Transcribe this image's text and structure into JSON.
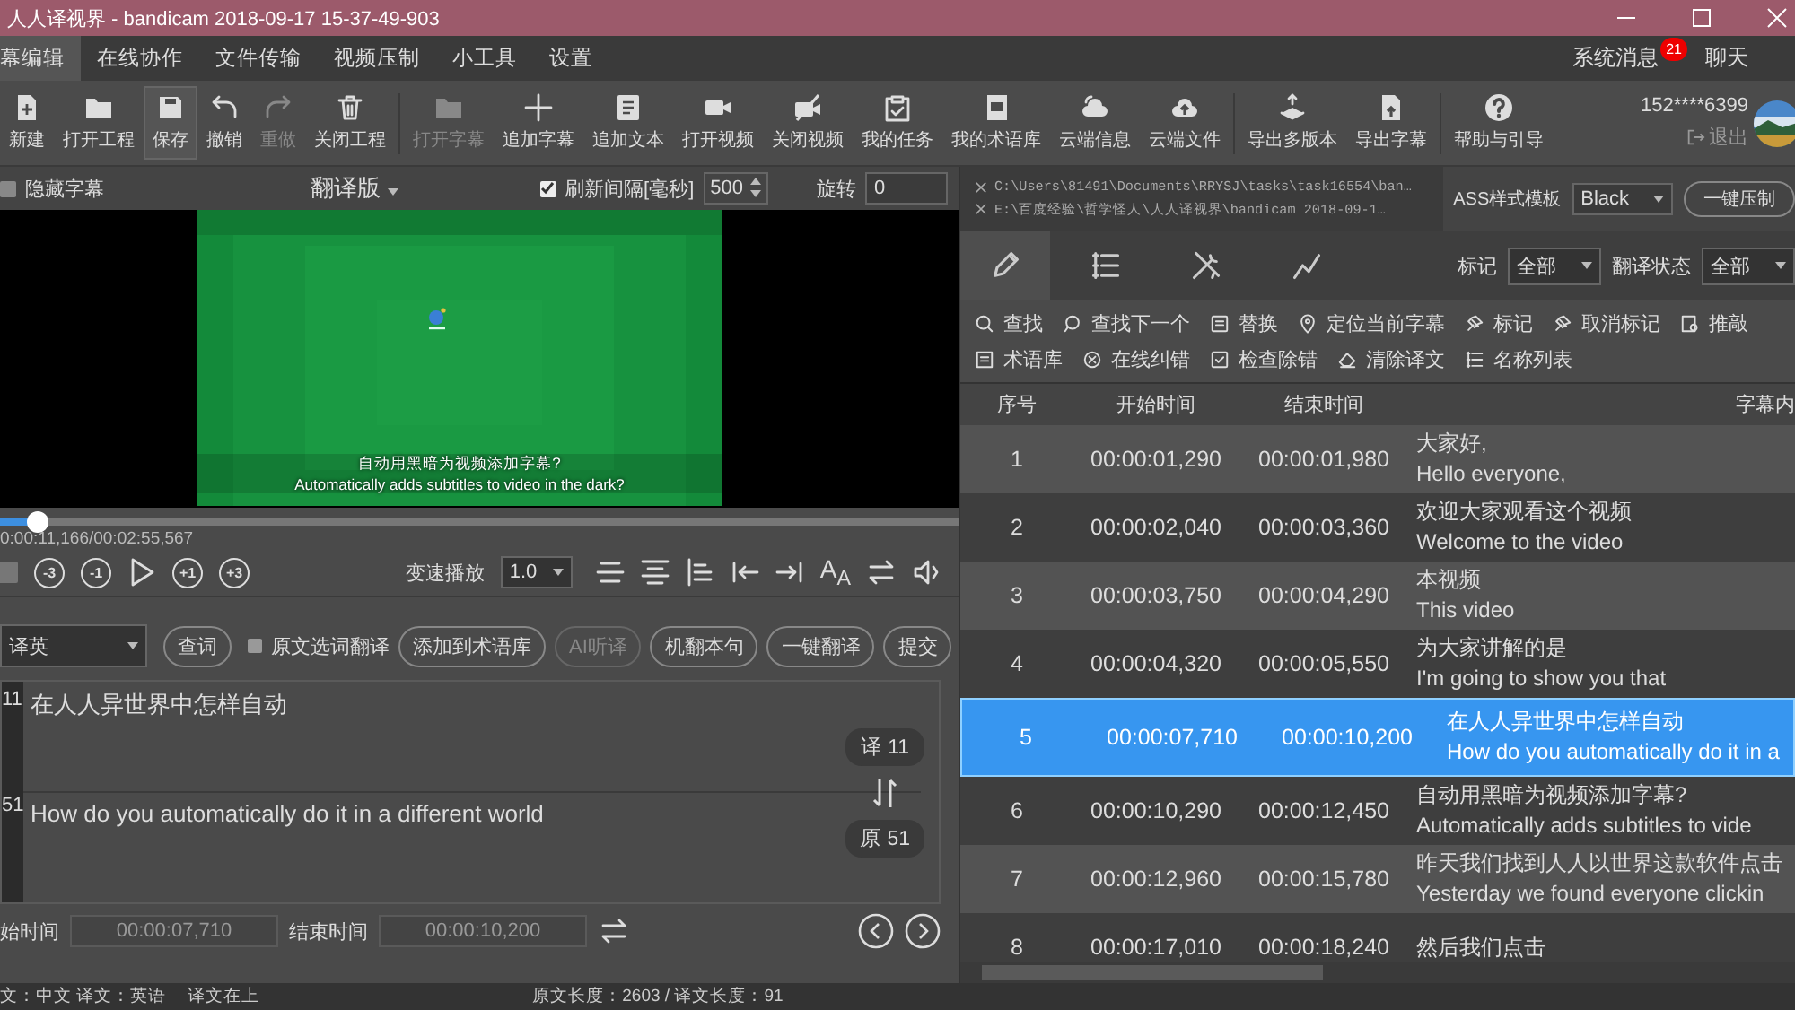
{
  "window": {
    "title": "人人译视界 - bandicam 2018-09-17 15-37-49-903"
  },
  "menu": {
    "items": [
      {
        "label": "幕编辑",
        "selected": true
      },
      {
        "label": "在线协作",
        "selected": false
      },
      {
        "label": "文件传输",
        "selected": false
      },
      {
        "label": "视频压制",
        "selected": false
      },
      {
        "label": "小工具",
        "selected": false
      },
      {
        "label": "设置",
        "selected": false
      }
    ],
    "messages": {
      "label": "系统消息",
      "badge": "21"
    },
    "chat": "聊天"
  },
  "toolbar": {
    "groups": [
      [
        {
          "label": "新建",
          "kind": "doc-plus",
          "disabled": false,
          "hovered": false
        },
        {
          "label": "打开工程",
          "kind": "folder",
          "disabled": false,
          "hovered": false
        },
        {
          "label": "保存",
          "kind": "floppy",
          "disabled": false,
          "hovered": true
        },
        {
          "label": "撤销",
          "kind": "undo",
          "disabled": false,
          "hovered": false
        },
        {
          "label": "重做",
          "kind": "redo",
          "disabled": true,
          "hovered": false
        },
        {
          "label": "关闭工程",
          "kind": "trash",
          "disabled": false,
          "hovered": false
        }
      ],
      [
        {
          "label": "打开字幕",
          "kind": "folder",
          "disabled": true,
          "hovered": false
        },
        {
          "label": "追加字幕",
          "kind": "plus",
          "disabled": false,
          "hovered": false
        },
        {
          "label": "追加文本",
          "kind": "document",
          "disabled": false,
          "hovered": false
        },
        {
          "label": "打开视频",
          "kind": "camera",
          "disabled": false,
          "hovered": false
        },
        {
          "label": "关闭视频",
          "kind": "camera-off",
          "disabled": false,
          "hovered": false
        },
        {
          "label": "我的任务",
          "kind": "clipboard",
          "disabled": false,
          "hovered": false
        },
        {
          "label": "我的术语库",
          "kind": "book",
          "disabled": false,
          "hovered": false
        },
        {
          "label": "云端信息",
          "kind": "cloud",
          "disabled": false,
          "hovered": false
        },
        {
          "label": "云端文件",
          "kind": "cloud-upload",
          "disabled": false,
          "hovered": false
        }
      ],
      [
        {
          "label": "导出多版本",
          "kind": "layers",
          "disabled": false,
          "hovered": false
        },
        {
          "label": "导出字幕",
          "kind": "file-upload",
          "disabled": false,
          "hovered": false
        }
      ],
      [
        {
          "label": "帮助与引导",
          "kind": "help",
          "disabled": false,
          "hovered": false
        }
      ]
    ]
  },
  "user": {
    "account": "152****6399",
    "logout": "退出"
  },
  "player": {
    "hide_subtitles": {
      "label": "隐藏字幕",
      "checked": false
    },
    "version": "翻译版",
    "refresh": {
      "label": "刷新间隔[毫秒]",
      "checked": true,
      "value": "500"
    },
    "rotate": {
      "label": "旋转",
      "value": "0"
    },
    "video": {
      "kind": "picture",
      "subtitle_lines": [
        "自动用黑暗为视频添加字幕?",
        "Automatically adds subtitles to video in the dark?"
      ]
    },
    "progress": {
      "level": 0.04
    },
    "time": "0:00:11,166/00:02:55,567",
    "controls": [
      {
        "kind": "stop"
      },
      {
        "kind": "rewind",
        "label": "-3"
      },
      {
        "kind": "rewind",
        "label": "-1"
      },
      {
        "kind": "play"
      },
      {
        "kind": "forward",
        "label": "+1"
      },
      {
        "kind": "forward",
        "label": "+3"
      }
    ],
    "speed": {
      "label": "变速播放",
      "value": "1.0"
    },
    "tools": [
      {
        "kind": "align-center"
      },
      {
        "kind": "align-middle"
      },
      {
        "kind": "align-left"
      },
      {
        "kind": "tab-left"
      },
      {
        "kind": "tab-right"
      },
      {
        "kind": "font",
        "label": "A$_{A}$"
      },
      {
        "kind": "swap"
      },
      {
        "kind": "speaker"
      }
    ]
  },
  "translator": {
    "direction": "译英",
    "items": [
      {
        "kind": "button",
        "label": "查词",
        "disabled": false
      },
      {
        "kind": "checkbox",
        "label": "原文选词翻译",
        "checked": false
      },
      {
        "kind": "button",
        "label": "添加到术语库",
        "disabled": false
      },
      {
        "kind": "button",
        "label": "AI听译",
        "disabled": true
      },
      {
        "kind": "button",
        "label": "机翻本句",
        "disabled": false
      },
      {
        "kind": "button",
        "label": "一键翻译",
        "disabled": false
      },
      {
        "kind": "button",
        "label": "提交",
        "disabled": false
      }
    ]
  },
  "editor": {
    "translation": {
      "line": "11",
      "text": "在人人异世界中怎样自动",
      "badge": "译 11"
    },
    "original": {
      "line": "51",
      "text": "How do you automatically do it in a different world",
      "badge": "原 51"
    }
  },
  "timing": {
    "start_label": "始时间",
    "start": "00:00:07,710",
    "end_label": "结束时间",
    "end": "00:00:10,200"
  },
  "status_bar": {
    "languages": "文：中文 译文：英语",
    "order": "译文在上",
    "lengths": "原文长度：2603 / 译文长度：91"
  },
  "files": {
    "paths": [
      "C:\\Users\\81491\\Documents\\RRYSJ\\tasks\\task16554\\ban…",
      "E:\\百度经验\\哲学怪人\\人人译视界\\bandicam 2018-09-1…"
    ],
    "style_label": "ASS样式模板",
    "style": "Black",
    "burn": "一键压制"
  },
  "panel_tabs": [
    {
      "kind": "pencil",
      "selected": true
    },
    {
      "kind": "list",
      "selected": false
    },
    {
      "kind": "tools",
      "selected": false
    },
    {
      "kind": "chart",
      "selected": false
    }
  ],
  "filters": [
    {
      "label": "标记",
      "value": "全部"
    },
    {
      "label": "翻译状态",
      "value": "全部"
    }
  ],
  "actions": [
    [
      {
        "kind": "search",
        "label": "查找"
      },
      {
        "kind": "search-next",
        "label": "查找下一个"
      },
      {
        "kind": "replace",
        "label": "替换"
      },
      {
        "kind": "location",
        "label": "定位当前字幕"
      },
      {
        "kind": "pin",
        "label": "标记"
      },
      {
        "kind": "pin",
        "label": "取消标记"
      },
      {
        "kind": "review",
        "label": "推敲"
      }
    ],
    [
      {
        "kind": "glossary",
        "label": "术语库"
      },
      {
        "kind": "x-circle",
        "label": "在线纠错"
      },
      {
        "kind": "check-box",
        "label": "检查除错"
      },
      {
        "kind": "eraser",
        "label": "清除译文"
      },
      {
        "kind": "list",
        "label": "名称列表"
      }
    ]
  ],
  "table": {
    "columns": [
      "序号",
      "开始时间",
      "结束时间",
      "字幕内"
    ],
    "rows": [
      {
        "index": "1",
        "start": "00:00:01,290",
        "end": "00:00:01,980",
        "source": "大家好,",
        "target": "Hello everyone,",
        "selected": false
      },
      {
        "index": "2",
        "start": "00:00:02,040",
        "end": "00:00:03,360",
        "source": "欢迎大家观看这个视频",
        "target": "Welcome to the video",
        "selected": false
      },
      {
        "index": "3",
        "start": "00:00:03,750",
        "end": "00:00:04,290",
        "source": "本视频",
        "target": "This video",
        "selected": false
      },
      {
        "index": "4",
        "start": "00:00:04,320",
        "end": "00:00:05,550",
        "source": "为大家讲解的是",
        "target": "I'm going to show you that",
        "selected": false
      },
      {
        "index": "5",
        "start": "00:00:07,710",
        "end": "00:00:10,200",
        "source": "在人人异世界中怎样自动",
        "target": "How do you automatically do it in a",
        "selected": true
      },
      {
        "index": "6",
        "start": "00:00:10,290",
        "end": "00:00:12,450",
        "source": "自动用黑暗为视频添加字幕?",
        "target": "Automatically adds subtitles to vide",
        "selected": false
      },
      {
        "index": "7",
        "start": "00:00:12,960",
        "end": "00:00:15,780",
        "source": "昨天我们找到人人以世界这款软件点击",
        "target": "Yesterday we found everyone clickin",
        "selected": false
      },
      {
        "index": "8",
        "start": "00:00:17,010",
        "end": "00:00:18,240",
        "source": "然后我们点击",
        "selected": false
      }
    ]
  }
}
